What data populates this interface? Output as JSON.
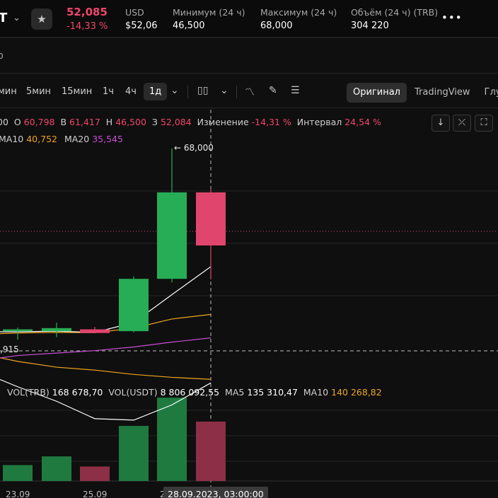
{
  "ticker": {
    "pair_fragment": "T",
    "price": "52,085",
    "change": "-14,33 %",
    "stats": [
      {
        "label": "USD",
        "value": "$52,06"
      },
      {
        "label": "Минимум (24 ч)",
        "value": "46,500"
      },
      {
        "label": "Максимум (24 ч)",
        "value": "68,000"
      },
      {
        "label": "Объём (24 ч) (TRB)",
        "value": "304 220"
      }
    ]
  },
  "subrow": {
    "tab_fragment": "р"
  },
  "toolbar": {
    "timeframes": [
      "мин",
      "5мин",
      "15мин",
      "1ч",
      "4ч",
      "1д"
    ],
    "active_timeframe": "1д",
    "views": [
      "Оригинал",
      "TradingView",
      "Глуби"
    ],
    "active_view": "Оригинал"
  },
  "info": {
    "o_fragment": "00",
    "o_label": "О",
    "o_value": "60,798",
    "h_label": "В",
    "h_value": "61,417",
    "l_label": "Н",
    "l_value": "46,500",
    "c_label": "З",
    "c_value": "52,084",
    "chg_label": "Изменение",
    "chg_value": "-14,31 %",
    "range_label": "Интервал",
    "range_value": "24,54 %"
  },
  "ma": {
    "ma10_label": "MA10",
    "ma10_value": "40,752",
    "ma20_label": "MA20",
    "ma20_value": "35,545"
  },
  "vol": {
    "trb_label": "VOL(TRB)",
    "trb_value": "168 678,70",
    "usdt_label": "VOL(USDT)",
    "usdt_value": "8 806 092,55",
    "ma5_label": "MA5",
    "ma5_value": "135 310,47",
    "ma10_label": "MA10",
    "ma10_value": "140 268,82"
  },
  "chart": {
    "high_label": "← 68,000",
    "price_axis_fragment": ",915",
    "date_labels": [
      "23.09",
      "25.09",
      "2"
    ],
    "crosshair_time": "28.09.2023, 03:00:00"
  },
  "colors": {
    "up": "#27ad55",
    "down": "#e0456d",
    "ma5": "#ffffff",
    "ma10": "#f0a51e",
    "ma20": "#c94fd6"
  },
  "chart_data": {
    "type": "candlestick",
    "candles": [
      {
        "open": 38.0,
        "high": 38.6,
        "low": 36.6,
        "close": 38.3
      },
      {
        "open": 38.0,
        "high": 39.4,
        "low": 37.0,
        "close": 38.5
      },
      {
        "open": 38.3,
        "high": 38.7,
        "low": 37.7,
        "close": 37.7
      },
      {
        "open": 38.0,
        "high": 47.0,
        "low": 37.8,
        "close": 46.6
      },
      {
        "open": 46.6,
        "high": 68.0,
        "low": 46.0,
        "close": 60.8
      },
      {
        "open": 60.8,
        "high": 61.4,
        "low": 46.5,
        "close": 52.08
      }
    ],
    "volumes": [
      {
        "value": 22000,
        "dir": "up"
      },
      {
        "value": 34000,
        "dir": "up"
      },
      {
        "value": 20000,
        "dir": "down"
      },
      {
        "value": 76000,
        "dir": "up"
      },
      {
        "value": 115000,
        "dir": "up"
      },
      {
        "value": 82000,
        "dir": "down"
      }
    ],
    "ma5": [
      37.9,
      38.0,
      37.8,
      39.4,
      44.0,
      48.6
    ],
    "ma10": [
      37.7,
      37.8,
      37.75,
      38.5,
      40.0,
      40.75
    ],
    "ma20": [
      34.0,
      34.4,
      34.8,
      35.4,
      36.2,
      36.9
    ],
    "vol_ma5": [
      130000,
      110000,
      86000,
      84000,
      105000,
      135310
    ],
    "vol_ma10": [
      165000,
      157000,
      153000,
      147000,
      143000,
      140268
    ]
  }
}
